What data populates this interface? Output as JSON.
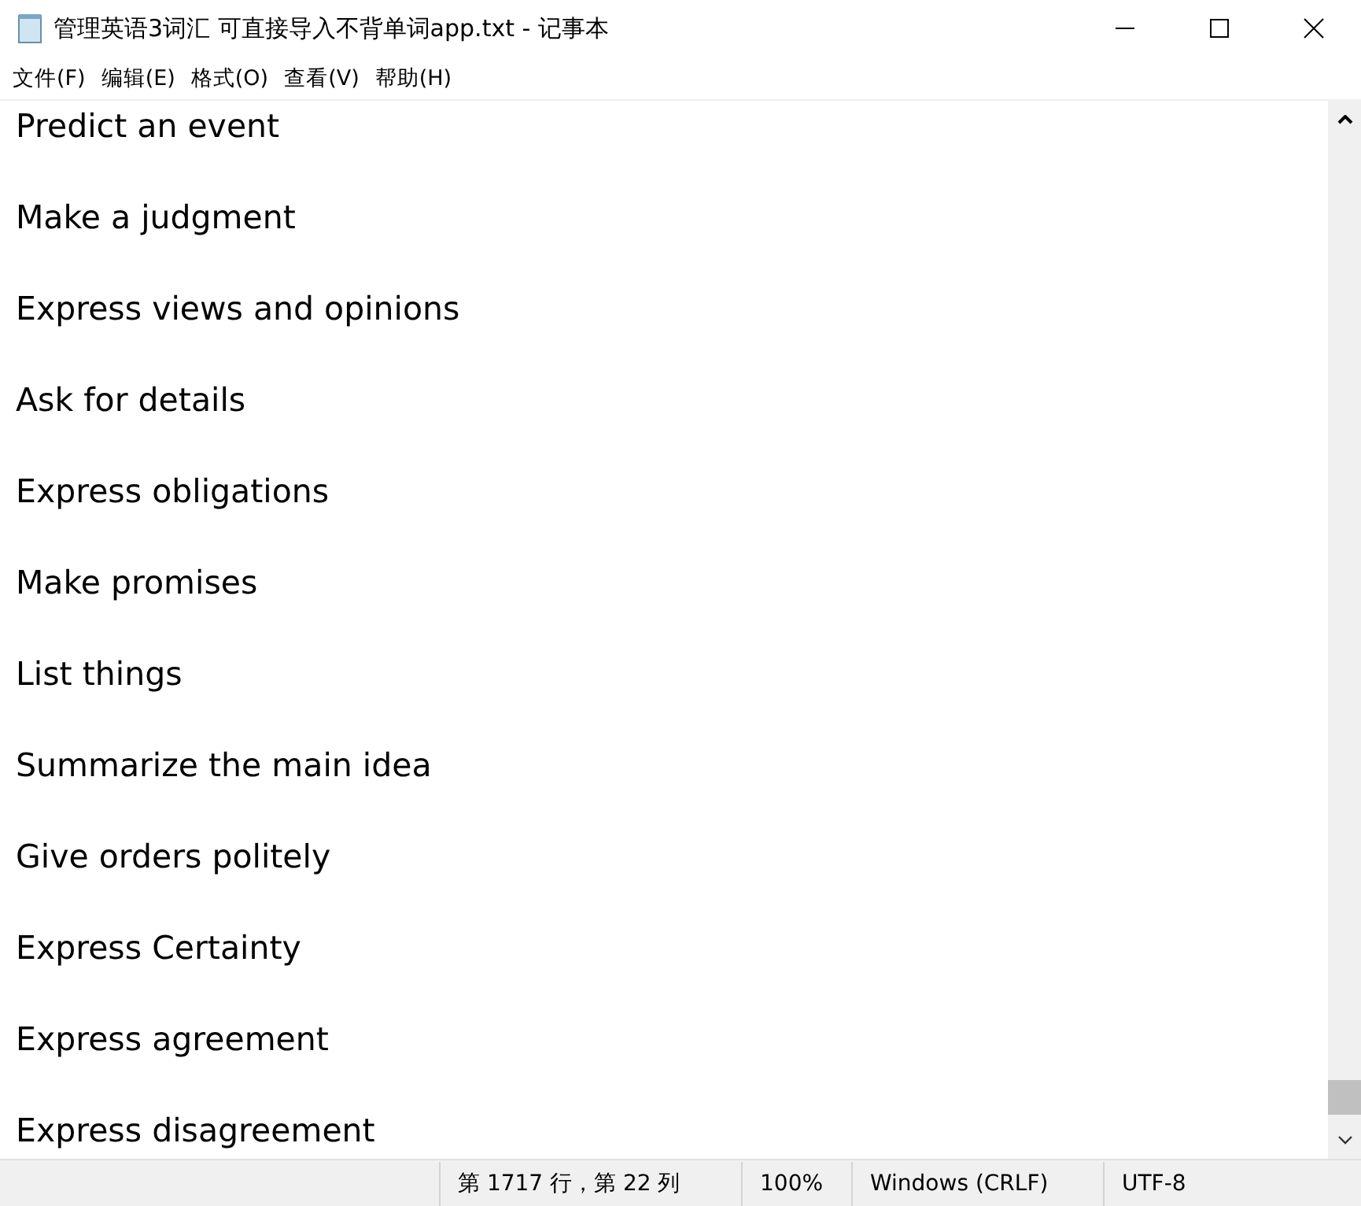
{
  "window": {
    "title": "管理英语3词汇 可直接导入不背单词app.txt - 记事本"
  },
  "menu": [
    {
      "label": "文件(F)"
    },
    {
      "label": "编辑(E)"
    },
    {
      "label": "格式(O)"
    },
    {
      "label": "查看(V)"
    },
    {
      "label": "帮助(H)"
    }
  ],
  "lines": [
    "Predict an event",
    "Make a judgment",
    "Express views and opinions",
    "Ask for details",
    "Express obligations",
    "Make promises",
    "List things",
    "Summarize the main idea",
    "Give orders politely",
    "Express Certainty",
    "Express agreement",
    "Express disagreement"
  ],
  "status_bar": [
    "第 1717 行，第 22 列",
    "100%",
    "Windows (CRLF)",
    "UTF-8"
  ]
}
